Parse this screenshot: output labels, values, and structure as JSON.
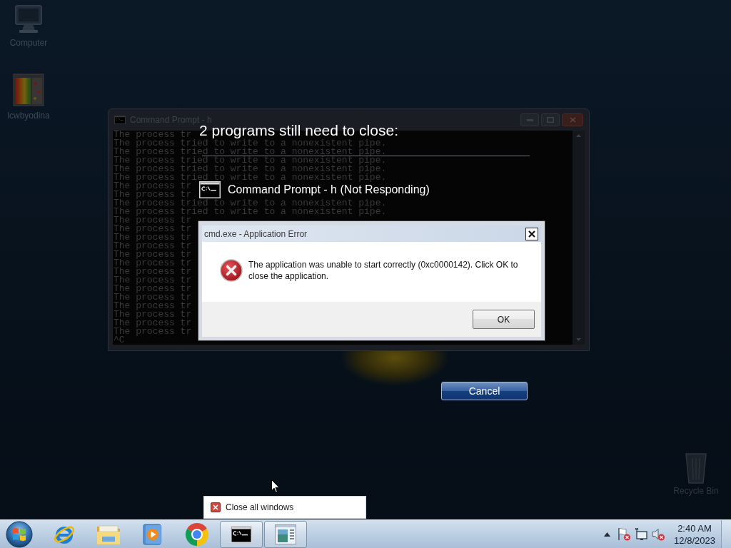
{
  "desktop": {
    "icons": [
      {
        "label": "Computer",
        "kind": "computer"
      },
      {
        "label": "lcwbyodina",
        "kind": "picture"
      }
    ],
    "recycle_bin": {
      "label": "Recycle Bin"
    }
  },
  "console_window": {
    "title": "Command Prompt - h",
    "lines": [
      "The process tr",
      "The process tried to write to a nonexistent pipe.",
      "The process tried to write to a nonexistent pipe.",
      "The process tried to write to a nonexistent pipe.",
      "The process tried to write to a nonexistent pipe.",
      "The process tried to write to a nonexistent pipe.",
      "The process tr",
      "The process tr",
      "The process tried to write to a nonexistent pipe.",
      "The process tried to write to a nonexistent pipe.",
      "The process tr",
      "The process tr",
      "The process tr",
      "The process tr",
      "The process tr",
      "The process tr",
      "The process tr",
      "The process tr",
      "The process tr",
      "The process tr",
      "The process tr",
      "The process tr",
      "The process tr",
      "The process tr",
      "^C"
    ]
  },
  "shutdown_screen": {
    "title": "2 programs still need to close:",
    "programs": [
      {
        "name": "Command Prompt - h (Not Responding)"
      }
    ],
    "cancel_button": "Cancel"
  },
  "error_dialog": {
    "title": "cmd.exe - Application Error",
    "message": "The application was unable to start correctly (0xc0000142). Click OK to close the application.",
    "buttons": [
      "OK"
    ]
  },
  "jump_list": {
    "items": [
      {
        "label": "Close all windows"
      }
    ]
  },
  "taskbar": {
    "apps": [
      {
        "kind": "browser",
        "open": false
      },
      {
        "kind": "folder",
        "open": false
      },
      {
        "kind": "media",
        "open": false
      },
      {
        "kind": "round_browser",
        "open": false
      },
      {
        "kind": "console",
        "open": true
      },
      {
        "kind": "window",
        "open": true
      }
    ],
    "tray": [
      {
        "kind": "flag",
        "alert": true
      },
      {
        "kind": "network",
        "alert": false
      },
      {
        "kind": "speaker",
        "alert": true
      }
    ],
    "clock": {
      "time": "2:40 AM",
      "date": "12/8/2023"
    }
  }
}
